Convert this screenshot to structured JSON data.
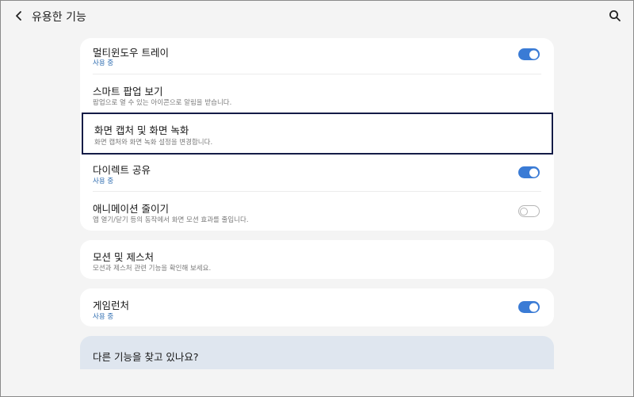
{
  "header": {
    "title": "유용한 기능"
  },
  "card1": {
    "items": [
      {
        "title": "멀티윈도우 트레이",
        "subtitle": "사용 중",
        "toggle": "on"
      },
      {
        "title": "스마트 팝업 보기",
        "subtitle": "팝업으로 열 수 있는 아이콘으로 알림을 받습니다."
      },
      {
        "title": "화면 캡처 및 화면 녹화",
        "subtitle": "화면 캡처와 화면 녹화 설정을 변경합니다."
      },
      {
        "title": "다이렉트 공유",
        "subtitle": "사용 중",
        "toggle": "on"
      },
      {
        "title": "애니메이션 줄이기",
        "subtitle": "앱 열기/닫기 등의 동작에서 화면 모션 효과를 줄입니다.",
        "toggle": "off"
      }
    ]
  },
  "card2": {
    "title": "모션 및 제스처",
    "subtitle": "모션과 제스처 관련 기능을 확인해 보세요."
  },
  "card3": {
    "title": "게임런처",
    "subtitle": "사용 중",
    "toggle": "on"
  },
  "suggestion": {
    "title": "다른 기능을 찾고 있나요?"
  },
  "colors": {
    "accent": "#3a7bd5",
    "status_on": "#2e6cb0",
    "selection_border": "#141c46",
    "background": "#f4f4f4"
  },
  "icons": {
    "back": "chevron-left-icon",
    "search": "search-icon"
  }
}
